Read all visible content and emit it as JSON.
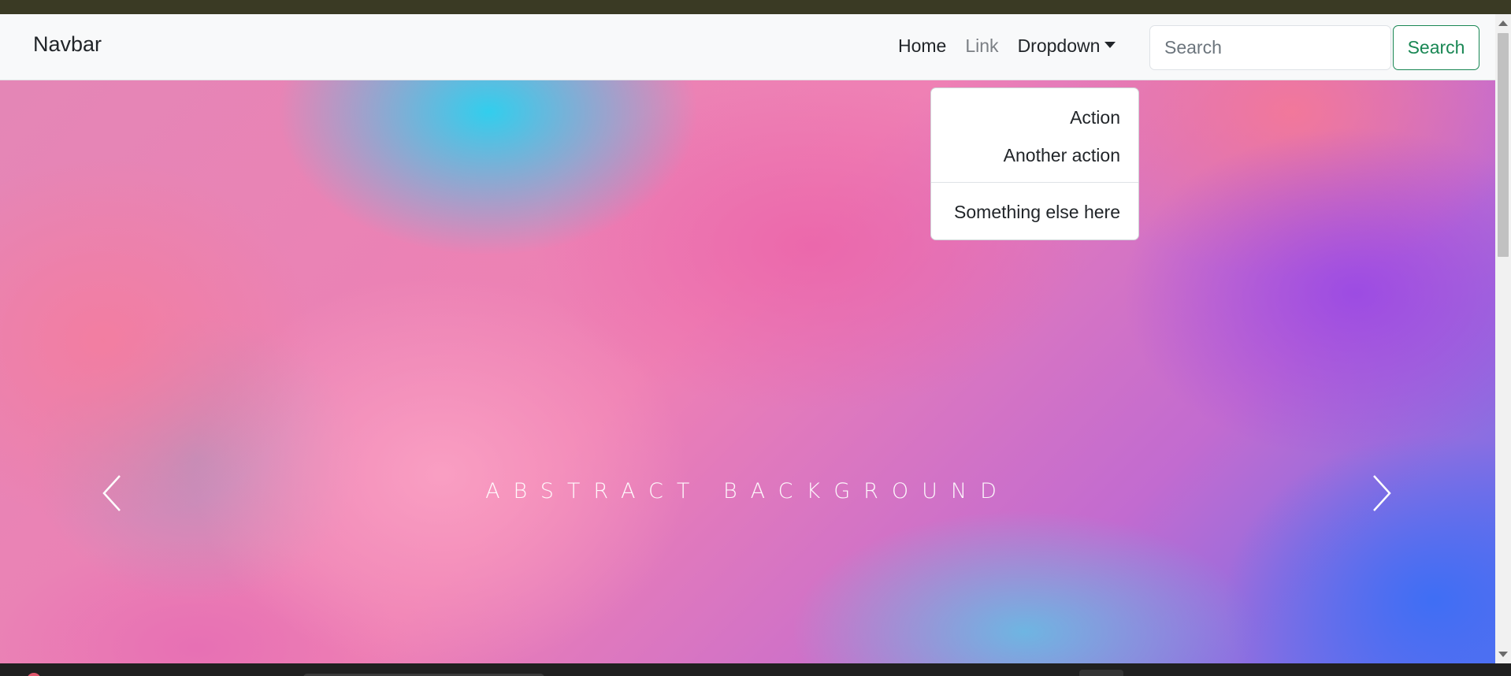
{
  "navbar": {
    "brand": "Navbar",
    "links": [
      {
        "label": "Home"
      },
      {
        "label": "Link"
      },
      {
        "label": "Dropdown"
      }
    ],
    "search": {
      "placeholder": "Search",
      "button_label": "Search"
    }
  },
  "dropdown": {
    "items": [
      {
        "label": "Action"
      },
      {
        "label": "Another action"
      },
      {
        "label": "Something else here"
      }
    ]
  },
  "hero": {
    "caption": "ABSTRACT BACKGROUND",
    "prev_icon": "chevron-left-icon",
    "next_icon": "chevron-right-icon"
  },
  "colors": {
    "navbar_bg": "#f8f9fa",
    "search_button": "#198754",
    "muted_link": "#7b7f84"
  }
}
